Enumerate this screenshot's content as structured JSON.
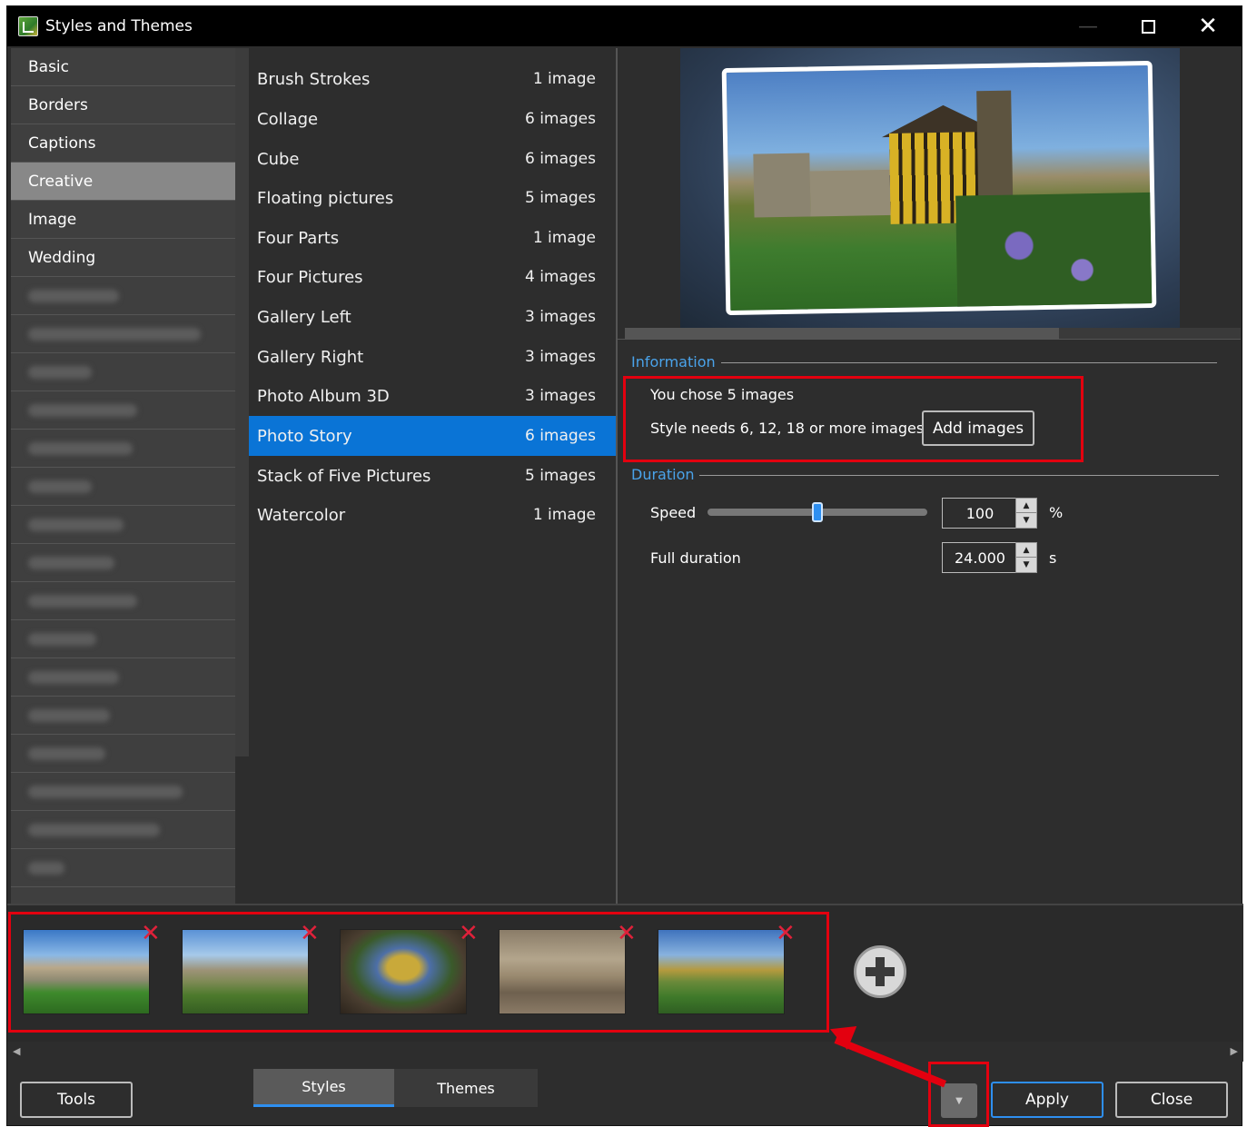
{
  "window": {
    "title": "Styles and Themes"
  },
  "titlebar": {
    "min": "—",
    "close": "✕"
  },
  "categories": {
    "items": [
      {
        "label": "Basic"
      },
      {
        "label": "Borders"
      },
      {
        "label": "Captions"
      },
      {
        "label": "Creative",
        "selected": true
      },
      {
        "label": "Image"
      },
      {
        "label": "Wedding"
      }
    ]
  },
  "styles": {
    "items": [
      {
        "label": "Brush Strokes",
        "count": "1 image"
      },
      {
        "label": "Collage",
        "count": "6 images"
      },
      {
        "label": "Cube",
        "count": "6 images"
      },
      {
        "label": "Floating pictures",
        "count": "5 images"
      },
      {
        "label": "Four Parts",
        "count": "1 image"
      },
      {
        "label": "Four Pictures",
        "count": "4 images"
      },
      {
        "label": "Gallery Left",
        "count": "3 images"
      },
      {
        "label": "Gallery Right",
        "count": "3 images"
      },
      {
        "label": "Photo Album 3D",
        "count": "3 images"
      },
      {
        "label": "Photo Story",
        "count": "6 images",
        "selected": true
      },
      {
        "label": "Stack of Five Pictures",
        "count": "5 images"
      },
      {
        "label": "Watercolor",
        "count": "1 image"
      }
    ]
  },
  "information": {
    "title": "Information",
    "chosen": "You chose 5 images",
    "needs": "Style needs 6, 12, 18 or more images",
    "add_button": "Add images"
  },
  "duration": {
    "title": "Duration",
    "speed_label": "Speed",
    "speed_value": "100",
    "speed_unit": "%",
    "speed_slider_fraction": 0.5,
    "full_label": "Full duration",
    "full_value": "24.000",
    "full_unit": "s"
  },
  "thumbnails": {
    "count": 5,
    "remove_glyph": "✕"
  },
  "bottom": {
    "tools_label": "Tools",
    "tab_styles": "Styles",
    "tab_themes": "Themes",
    "active_tab": "Styles",
    "apply_label": "Apply",
    "close_label": "Close"
  },
  "colors": {
    "selection": "#0a74d6",
    "accent_text": "#4aa3ea",
    "annotation": "#e3000f",
    "remove_x": "#e0213a"
  }
}
